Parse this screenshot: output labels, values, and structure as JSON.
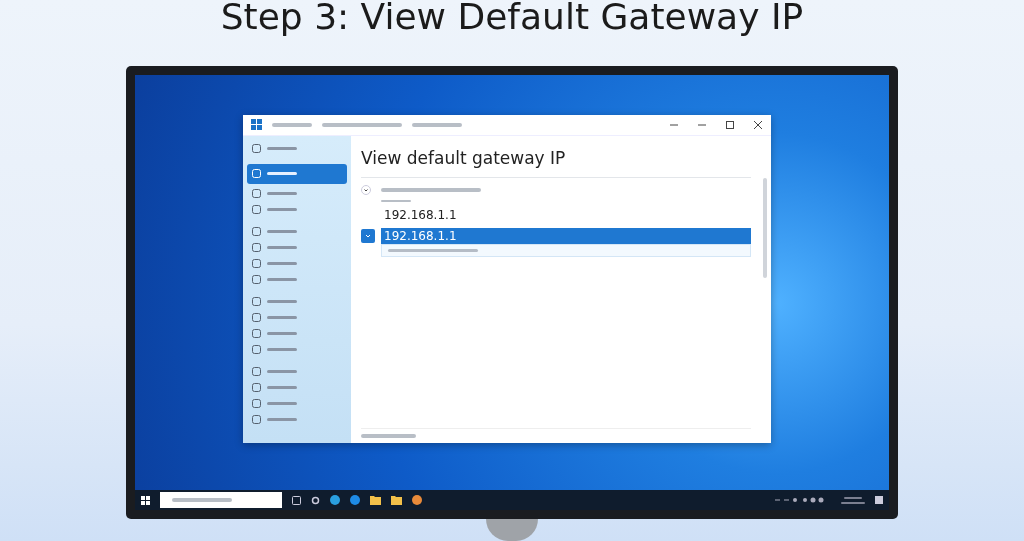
{
  "title": "Step 3: View Default Gateway IP",
  "window": {
    "heading": "View default gateway IP"
  },
  "sidebar": {
    "items": [
      {
        "selected": false
      },
      {
        "selected": true
      },
      {
        "selected": false
      },
      {
        "selected": false
      },
      {
        "selected": false
      },
      {
        "selected": false
      },
      {
        "selected": false
      },
      {
        "selected": false
      },
      {
        "selected": false
      },
      {
        "selected": false
      },
      {
        "selected": false
      },
      {
        "selected": false
      },
      {
        "selected": false
      },
      {
        "selected": false
      },
      {
        "selected": false
      },
      {
        "selected": false
      }
    ]
  },
  "results": [
    {
      "value": "192.168.1.1",
      "selected": false
    },
    {
      "value": "192.168.1.1",
      "selected": true
    }
  ]
}
